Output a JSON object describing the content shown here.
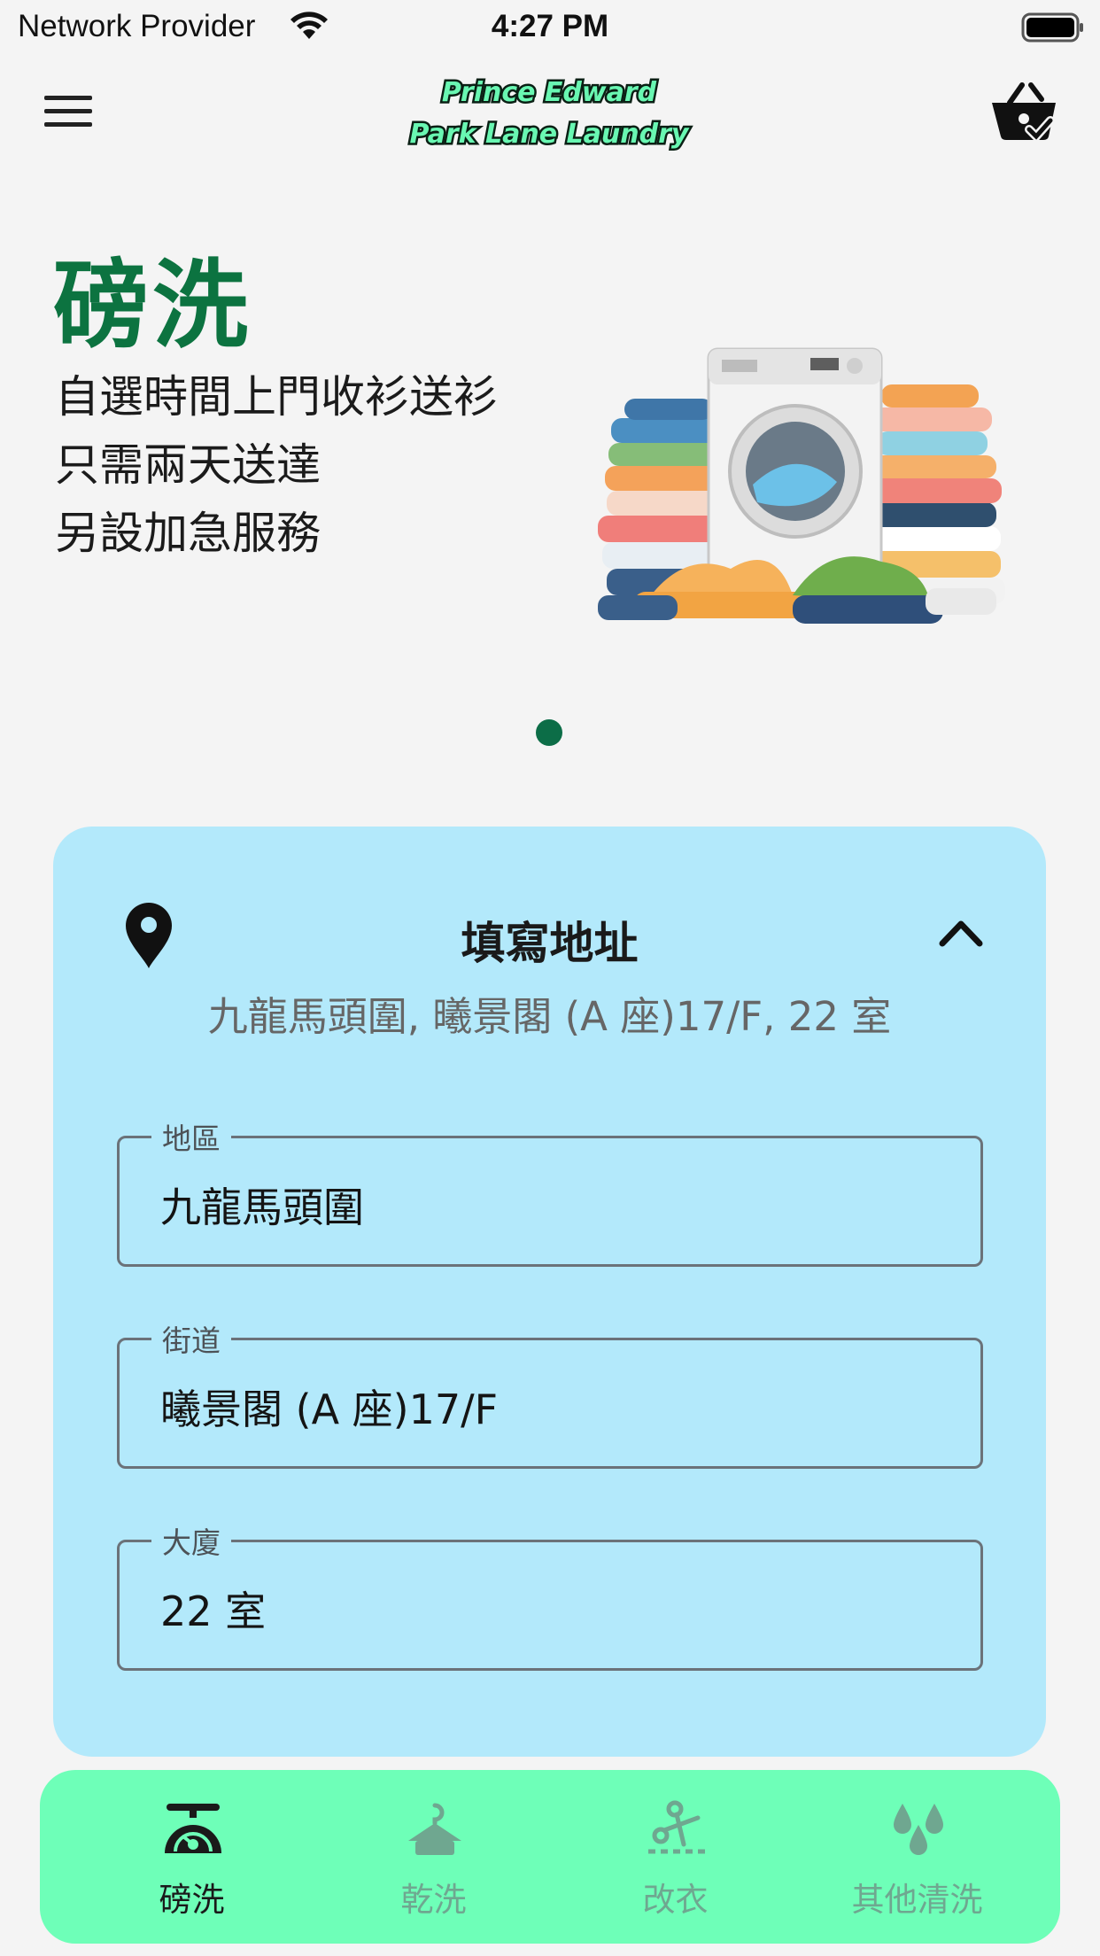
{
  "status_bar": {
    "carrier": "Network Provider",
    "time": "4:27 PM"
  },
  "header": {
    "logo_line1": "Prince Edward",
    "logo_line2": "Park Lane Laundry",
    "menu_icon": "hamburger-menu-icon",
    "cart_icon": "basket-check-icon"
  },
  "hero": {
    "title": "磅洗",
    "line1": "自選時間上門收衫送衫",
    "line2": "只需兩天送達",
    "line3": "另設加急服務",
    "image": "washing-machine-with-clothes-illustration",
    "slide_count": 1,
    "active_slide": 1
  },
  "address_card": {
    "title": "填寫地址",
    "summary": "九龍馬頭圍, 曦景閣 (A 座)17/F, 22 室",
    "fields": [
      {
        "label": "地區",
        "value": "九龍馬頭圍"
      },
      {
        "label": "街道",
        "value": "曦景閣 (A 座)17/F"
      },
      {
        "label": "大廈",
        "value": "22 室"
      }
    ]
  },
  "bottom_nav": {
    "items": [
      {
        "label": "磅洗",
        "icon": "scale-icon",
        "active": true
      },
      {
        "label": "乾洗",
        "icon": "hanger-icon",
        "active": false
      },
      {
        "label": "改衣",
        "icon": "scissors-icon",
        "active": false
      },
      {
        "label": "其他清洗",
        "icon": "water-drops-icon",
        "active": false
      }
    ]
  },
  "colors": {
    "brand_green": "#0c7340",
    "card_bg": "#b3e9fb",
    "nav_bg": "#6effb8",
    "inactive_nav": "#6fa790"
  }
}
